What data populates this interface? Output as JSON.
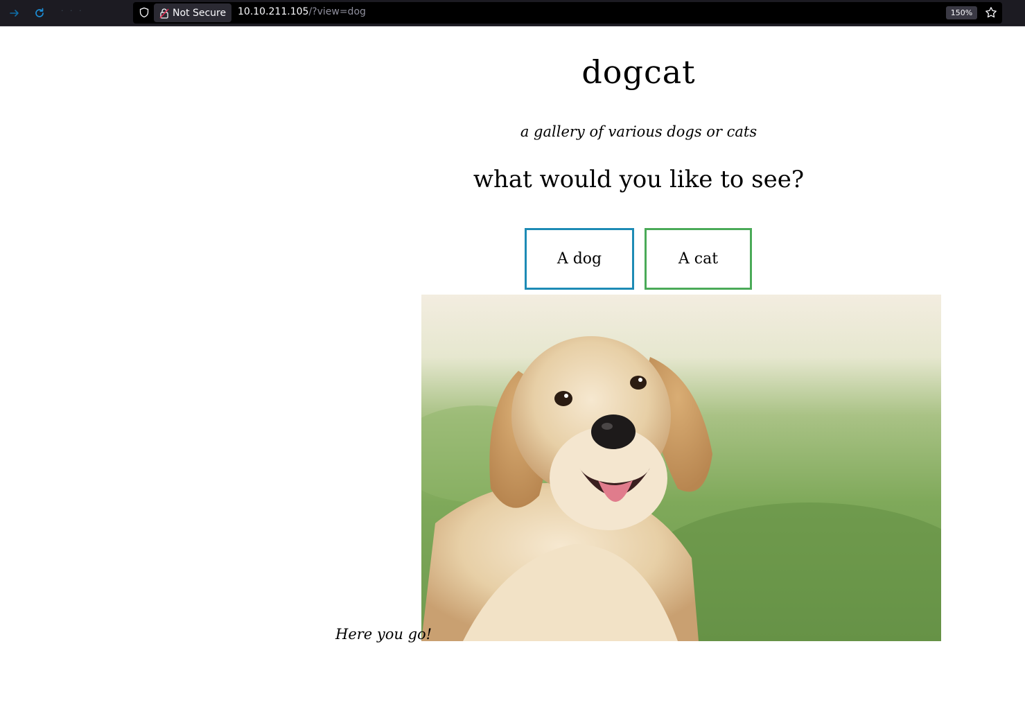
{
  "browser": {
    "security_label": "Not Secure",
    "url_host": "10.10.211.105",
    "url_path": "/?view=dog",
    "zoom": "150%",
    "icons": [
      "forward-arrow-icon",
      "reload-icon",
      "shield-icon",
      "lock-icon",
      "star-icon"
    ]
  },
  "page": {
    "title": "dogcat",
    "subtitle": "a gallery of various dogs or cats",
    "question": "what would you like to see?",
    "buttons": {
      "dog": "A dog",
      "cat": "A cat"
    },
    "image": {
      "subject": "golden retriever on grass"
    },
    "caption": "Here you go!"
  },
  "colors": {
    "dog_button_border": "#1d8bb5",
    "cat_button_border": "#4aaa58",
    "toolbar_bg": "#1c1b22"
  }
}
